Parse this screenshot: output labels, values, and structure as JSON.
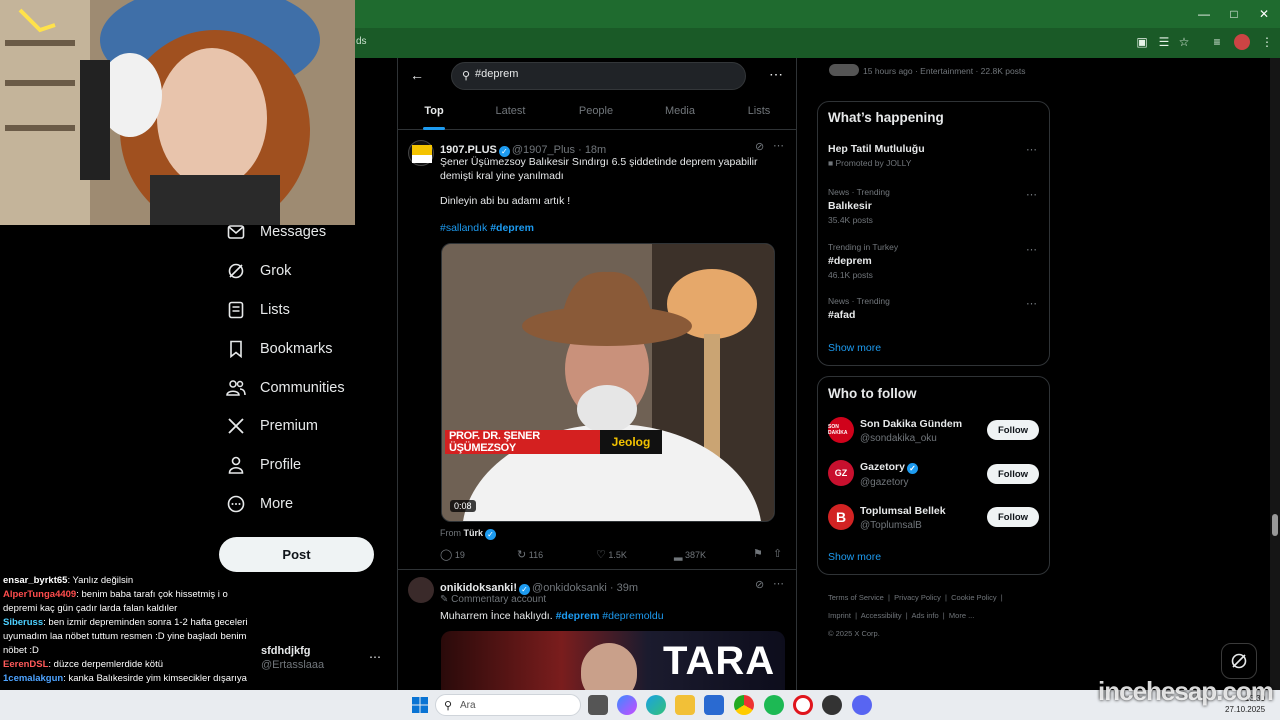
{
  "browser": {
    "address_fragment": "ds"
  },
  "nav": {
    "items": [
      {
        "label": "Messages",
        "icon": "mail-icon"
      },
      {
        "label": "Grok",
        "icon": "grok-icon"
      },
      {
        "label": "Lists",
        "icon": "list-icon"
      },
      {
        "label": "Bookmarks",
        "icon": "bookmark-icon"
      },
      {
        "label": "Communities",
        "icon": "people-icon"
      },
      {
        "label": "Premium",
        "icon": "x-logo-icon"
      },
      {
        "label": "Profile",
        "icon": "person-icon"
      },
      {
        "label": "More",
        "icon": "more-circle-icon"
      }
    ],
    "post_label": "Post",
    "account": {
      "name": "sfdhdjkfg",
      "handle": "@Ertasslaaa"
    }
  },
  "chat": [
    {
      "user": "ensar_byrkt65",
      "user_color": "#ffffff",
      "text": ": Yanlız değilsin"
    },
    {
      "user": "AlperTunga4409",
      "user_color": "#ff4d4d",
      "text": ": benim baba tarafı çok hissetmiş i o depremi kaç gün çadır larda falan kaldıler"
    },
    {
      "user": "Siberuss",
      "user_color": "#4dd0ff",
      "text": ": ben izmir depreminden sonra 1-2 hafta geceleri uyumadım laa nöbet tuttum resmen :D yine başladı benim nöbet :D"
    },
    {
      "user": "EerenDSL",
      "user_color": "#ff5a5a",
      "text": ": düzce derpemlerdide kötü"
    },
    {
      "user": "1cemalakgun",
      "user_color": "#4da3ff",
      "text": ": kanka Balıkesirde yim kimsecikler dışarıya"
    }
  ],
  "search": {
    "value": "#deprem"
  },
  "tabs": [
    "Top",
    "Latest",
    "People",
    "Media",
    "Lists"
  ],
  "tweet1": {
    "name": "1907.PLUS",
    "handle": "@1907_Plus",
    "time": "18m",
    "text1": "Şener Üşümezsoy Balıkesir Sındırgı 6.5 şiddetinde deprem yapabilir demişti kral yine yanılmadı",
    "text2": "Dinleyin abi bu adamı artık !",
    "tag1": "#sallandık",
    "tag2": "#deprem",
    "video_banner_name": "PROF. DR. ŞENER ÜŞÜMEZSOY",
    "video_banner_role": "Jeolog",
    "video_time": "0:08",
    "from_label": "From",
    "from_source": "Türk",
    "replies": "19",
    "reposts": "116",
    "likes": "1.5K",
    "views": "387K"
  },
  "tweet2": {
    "name": "onikidoksanki!",
    "handle": "@onkidoksanki",
    "time": "39m",
    "account_type": "Commentary account",
    "text": "Muharrem İnce haklıydı.",
    "tag1": "#deprem",
    "tag2": "#depremoldu",
    "media_text": "TARA"
  },
  "sidebar": {
    "top_meta": "15 hours ago · Entertainment · 22.8K posts",
    "whats_happening_title": "What’s happening",
    "trends": [
      {
        "meta": "",
        "name": "Hep Tatil Mutluluğu",
        "sub": "Promoted by JOLLY"
      },
      {
        "meta": "News · Trending",
        "name": "Balıkesir",
        "sub": "35.4K posts"
      },
      {
        "meta": "Trending in Turkey",
        "name": "#deprem",
        "sub": "46.1K posts"
      },
      {
        "meta": "News · Trending",
        "name": "#afad",
        "sub": ""
      }
    ],
    "show_more": "Show more",
    "who_to_follow_title": "Who to follow",
    "follow_suggestions": [
      {
        "name": "Son Dakika Gündem",
        "handle": "@sondakika_oku",
        "verified": false,
        "avatar_color": "#d0021b",
        "avatar_text": "SON DAKİKA"
      },
      {
        "name": "Gazetory",
        "handle": "@gazetory",
        "verified": true,
        "avatar_color": "#c8102e",
        "avatar_text": "GZ"
      },
      {
        "name": "Toplumsal Bellek",
        "handle": "@ToplumsalB",
        "verified": false,
        "avatar_color": "#d22323",
        "avatar_text": "B"
      }
    ],
    "follow_label": "Follow",
    "footer_links": [
      "Terms of Service",
      "Privacy Policy",
      "Cookie Policy",
      "Imprint",
      "Accessibility",
      "Ads info",
      "More ..."
    ],
    "copyright": "© 2025 X Corp."
  },
  "taskbar": {
    "search_placeholder": "Ara",
    "time": "13:30",
    "date": "27.10.2025"
  },
  "watermark": "incehesap.com"
}
